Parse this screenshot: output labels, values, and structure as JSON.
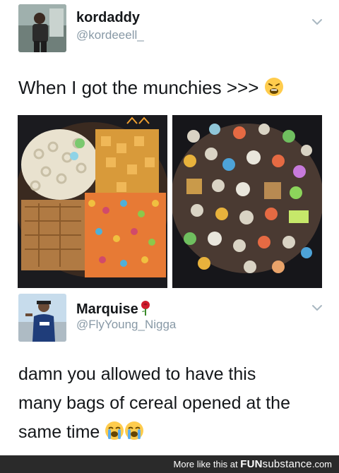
{
  "tweet1": {
    "display_name": "kordaddy",
    "handle": "@kordeeell_",
    "text": "When I got the munchies >>>",
    "emoji": "weary-face-icon"
  },
  "tweet2": {
    "display_name": "Marquise",
    "handle": "@FlyYoung_Nigga",
    "text_line1": "damn you allowed to have this",
    "text_line2": "many bags of cereal opened at the",
    "text_line3": "same time",
    "emojis": [
      "loudly-crying-face-icon",
      "loudly-crying-face-icon"
    ]
  },
  "footer": {
    "prefix": "More like this at",
    "brand_main": "FUN",
    "brand_sub": "substance",
    "brand_tld": ".com"
  },
  "colors": {
    "text": "#14171a",
    "muted": "#8899a6",
    "footer_bg": "#2a2a2a"
  }
}
